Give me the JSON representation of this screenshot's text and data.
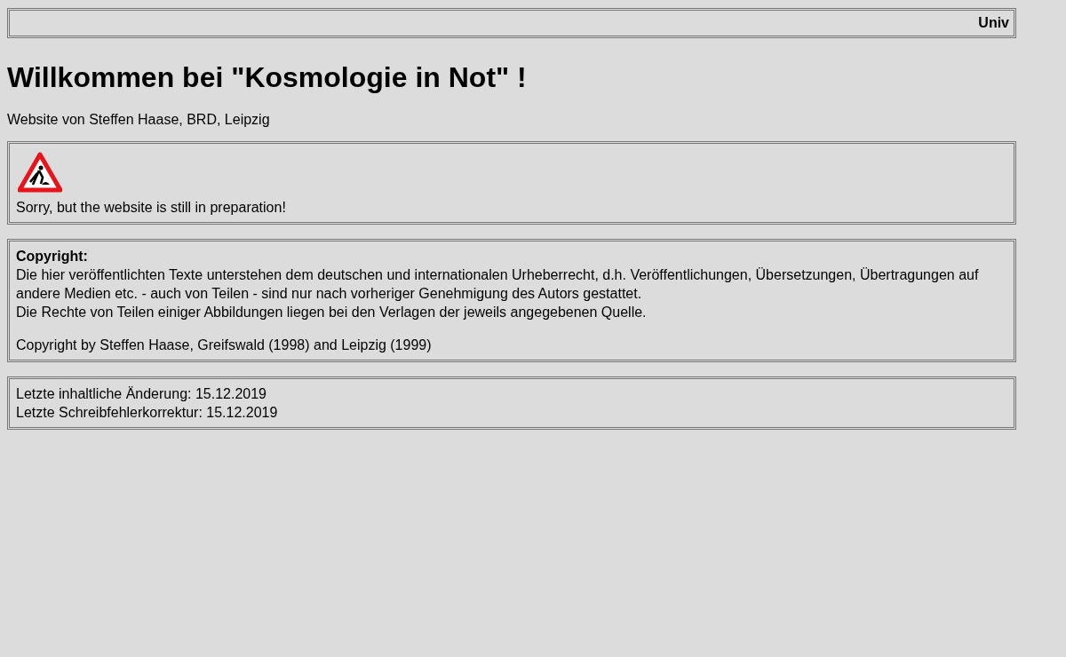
{
  "marquee": {
    "text": "Univ"
  },
  "heading": "Willkommen bei \"Kosmologie in Not\" !",
  "subtitle": "Website von Steffen Haase, BRD, Leipzig",
  "notice": {
    "text": "Sorry, but the website is still in preparation!"
  },
  "copyright": {
    "title": "Copyright:",
    "lines": [
      "Die hier veröffentlichten Texte unterstehen dem deutschen und internationalen Urheberrecht, d.h. Veröffentlichungen, Übersetzungen, Übertragungen auf andere Medien etc. - auch von Teilen - sind nur nach vorheriger Genehmigung des Autors gestattet.",
      "Die Rechte von Teilen einiger Abbildungen liegen bei den Verlagen der jeweils angegebenen Quelle."
    ],
    "footer": "Copyright by Steffen Haase, Greifswald (1998) and Leipzig (1999)"
  },
  "changes": [
    "Letzte inhaltliche Änderung: 15.12.2019",
    "Letzte Schreibfehlerkorrektur: 15.12.2019"
  ]
}
